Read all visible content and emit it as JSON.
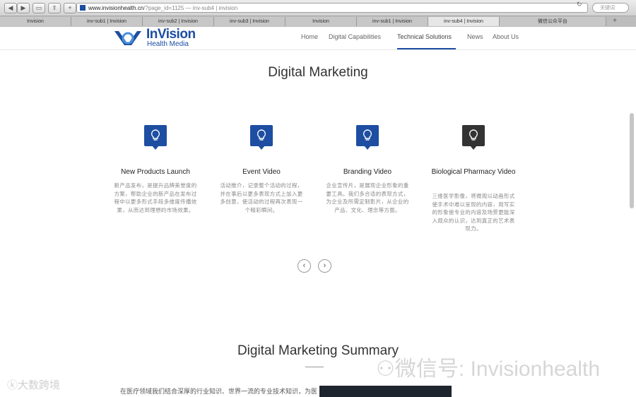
{
  "browser": {
    "url_host": "www.invisionhealth.cn",
    "url_path": "/?page_id=1125 — inv-sub4 | invision",
    "search_placeholder": "关键词",
    "tabs": [
      "Invision",
      "inv-sub1 | Invision",
      "inv-sub2 | Invision",
      "inv-sub3 | Invision",
      "Invision",
      "inv-sub1 | Invision",
      "inv-sub4 | Invision",
      "微信公众平台"
    ]
  },
  "header": {
    "logo_text": "InVision",
    "logo_sub": "Health Media",
    "nav": [
      "Home",
      "Digital Capabilities",
      "Technical Solutions",
      "News",
      "About Us"
    ],
    "active_nav": "Technical Solutions",
    "brand_color": "#1d4ea2"
  },
  "section": {
    "title": "Digital Marketing",
    "cards": [
      {
        "title": "New Products Launch",
        "icon": "lightbulb-icon",
        "icon_color": "#1d4ea2",
        "desc": "新产品发布，是提升品牌美誉度的方案，帮助企业的新产品在发布过程中以更多形式手段多维度传播效果，从而达到理想的市场效果。"
      },
      {
        "title": "Event Video",
        "icon": "lightbulb-icon",
        "icon_color": "#1d4ea2",
        "desc": "活动推介，记录整个活动的过程，并在事后以更多表现方式上加入更多创意，使活动的过程再次表现一个精彩瞬间。"
      },
      {
        "title": "Branding Video",
        "icon": "lightbulb-icon",
        "icon_color": "#1d4ea2",
        "desc": "企业宣传片，是展现企业形象的重要工具。我们多合适的表现方式，为企业及所需定制影片，从企业的产品、文化、理念等方面。"
      },
      {
        "title": "Biological Pharmacy Video",
        "icon": "lightbulb-icon",
        "icon_color": "#333333",
        "desc": "三维医学影像，将微观以动画形式使手术中难以呈现的内容，用写实的形象使专业的内容及场景更能深入观众的认识，达到真正的艺术表现力。"
      }
    ],
    "prev_label": "‹",
    "next_label": "›"
  },
  "summary": {
    "title": "Digital Marketing Summary",
    "body_preview": "在医疗领域我们结合深厚的行业知识、世界一流的专业技术知识，为医"
  },
  "watermarks": {
    "left": "大数跨境",
    "right": "微信号: Invisionhealth"
  }
}
